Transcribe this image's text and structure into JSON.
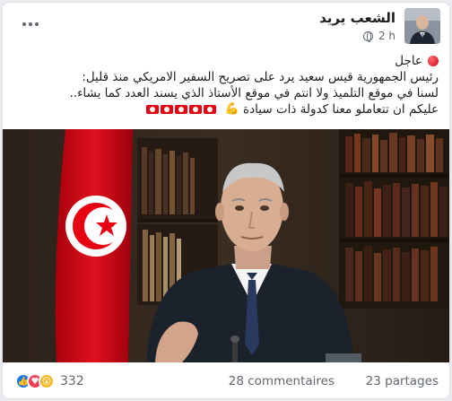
{
  "post": {
    "page_name": "الشعب يريد",
    "time": "2 h",
    "text": {
      "line1": "عاجل",
      "line2": "رئيس الجمهورية قيس سعيد يرد على تصريح السفير الامريكي منذ قليل:",
      "line3": "لسنا في موقع التلميذ ولا انتم في موقع الأستاذ الذي يسند العدد كما يشاء..",
      "line4": "عليكم ان تتعاملو معنا كدولة ذات سيادة"
    },
    "icons": {
      "more": "more-icon",
      "globe": "globe-icon",
      "red_dot": "red-circle-icon",
      "muscle": "flexed-biceps-icon",
      "flag": "tunisia-flag-icon"
    }
  },
  "footer": {
    "reaction_count": "332",
    "comments": "28 commentaires",
    "shares": "23 partages"
  },
  "colors": {
    "accent": "#1877f2",
    "flag_red": "#e70013",
    "like": "#1877f2",
    "love": "#f33e58",
    "wow": "#f7b928"
  }
}
